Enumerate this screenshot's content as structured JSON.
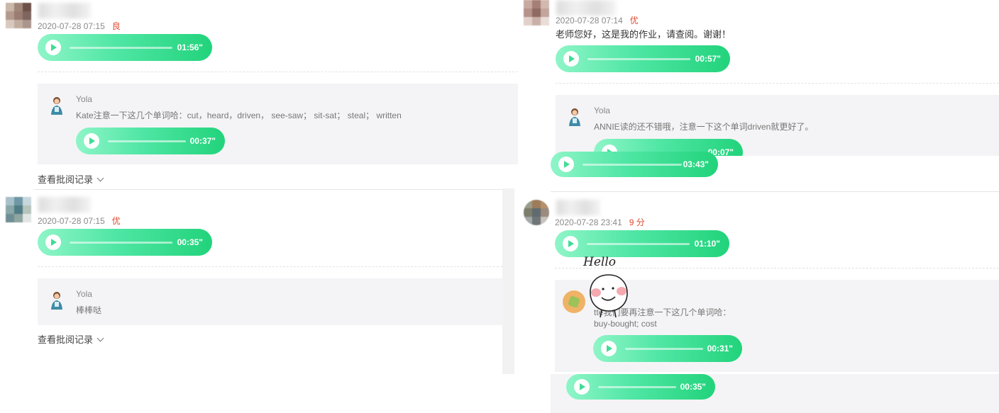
{
  "posts": [
    {
      "date": "2020-07-28 07:15",
      "grade": "良",
      "text": "",
      "audio": "01:56\"",
      "review": {
        "name": "Yola",
        "lines": [
          "Kate注意一下这几个单词哈：cut，heard，driven， see-saw； sit-sat； steal； written"
        ],
        "audio": "00:37\""
      },
      "history": "查看批阅记录"
    },
    {
      "date": "2020-07-28 07:14",
      "grade": "优",
      "text": "老师您好，这是我的作业，请查阅。谢谢！",
      "audio": "00:57\"",
      "review": {
        "name": "Yola",
        "lines": [
          "ANNIE读的还不错哦，注意一下这个单词driven就更好了。"
        ],
        "audio": "00:07\""
      },
      "extra_audio": "03:43\""
    },
    {
      "date": "2020-07-28 07:15",
      "grade": "优",
      "text": "",
      "audio": "00:35\"",
      "review": {
        "name": "Yola",
        "lines": [
          "棒棒哒"
        ]
      },
      "history": "查看批阅记录"
    },
    {
      "date": "2020-07-28 23:41",
      "grade": "9 分",
      "text": "",
      "audio": "01:10\"",
      "review": {
        "name": "",
        "lines": [
          "tte我们要再注意一下这几个单词哈：",
          "buy-bought; cost"
        ],
        "audio": "00:31\""
      },
      "extra_audio": "00:35\"",
      "sticker_text": "Hello"
    }
  ],
  "colors": {
    "grade": "#e0492f",
    "audio_start": "#8ff5c8",
    "audio_end": "#22d37b",
    "review_bg": "#f4f4f6"
  },
  "icons": [
    "play-icon",
    "teacher-avatar-icon",
    "chevron-down-icon",
    "hello-sticker-icon"
  ]
}
